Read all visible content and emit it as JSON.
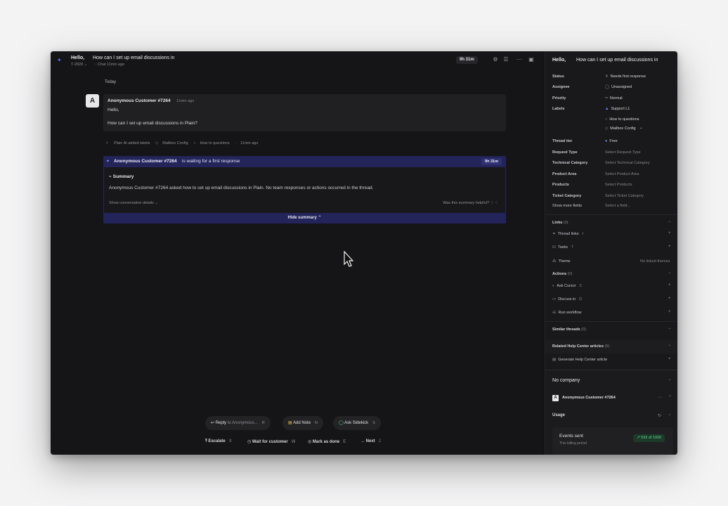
{
  "header": {
    "greeting": "Hello,",
    "thread_title": "How can I set up email discussions in",
    "thread_id": "T-2828 ⌄",
    "channel": "Chat 11min ago",
    "timer": "9h 31m"
  },
  "timeline": {
    "day": "Today",
    "message": {
      "avatar": "A",
      "author": "Anonymous Customer #7264",
      "time": "11min ago",
      "line1": "Hello,",
      "line2": "How can I set up email discussions in Plain?"
    },
    "labels_event": {
      "actor": "Plain AI added labels",
      "label1": "Mailbox Config",
      "label2": "How to questions",
      "time": "11min ago"
    },
    "waiting": {
      "customer": "Anonymous Customer #7264",
      "text": "is waiting for a first response",
      "timer": "9h 31m"
    },
    "summary": {
      "title": "Summary",
      "body": "Anonymous Customer #7264 asked how to set up email discussions in Plain. No team responses or actions occurred in the thread.",
      "show_details": "Show conversation details ⌄",
      "helpful": "Was this summary helpful?",
      "hide": "Hide summary ⌃"
    }
  },
  "composer": {
    "reply": "Reply",
    "reply_to": "to Anonymous...",
    "reply_key": "R",
    "note": "Add Note",
    "note_key": "N",
    "sidekick": "Ask Sidekick",
    "sidekick_key": "S",
    "escalate": "Escalate",
    "escalate_key": "X",
    "wait": "Wait for customer",
    "wait_key": "W",
    "done": "Mark as done",
    "done_key": "E",
    "next": "Next",
    "next_key": "J"
  },
  "sidebar": {
    "greeting": "Hello,",
    "thread_title": "How can I set up email discussions in",
    "fields": {
      "status_label": "Status",
      "status_value": "Needs first response",
      "assignee_label": "Assignee",
      "assignee_value": "Unassigned",
      "priority_label": "Priority",
      "priority_value": "Normal",
      "labels_label": "Labels",
      "label1": "Support L1",
      "label2": "How to questions",
      "label3": "Mailbox Config",
      "tier_label": "Thread tier",
      "tier_value": "Free",
      "request_label": "Request Type",
      "request_value": "Select Request Type",
      "tech_label": "Technical Category",
      "tech_value": "Select Technical Category",
      "area_label": "Product Area",
      "area_value": "Select Product Area",
      "products_label": "Products",
      "products_value": "Select Products",
      "ticket_label": "Ticket Category",
      "ticket_value": "Select Ticket Category",
      "more_label": "Show more fields",
      "more_value": "Select a field..."
    },
    "links": {
      "title": "Links",
      "count": "(0)",
      "thread_links": "Thread links",
      "thread_links_key": "I",
      "tasks": "Tasks",
      "tasks_key": "T",
      "theme": "Theme",
      "theme_value": "No linked themes"
    },
    "actions": {
      "title": "Actions",
      "count": "(0)",
      "cursor": "Ask Cursor",
      "cursor_key": "C",
      "discuss": "Discuss in",
      "discuss_key": "D",
      "workflow": "Run workflow"
    },
    "similar": {
      "title": "Similar threads",
      "count": "(0)"
    },
    "help": {
      "title": "Related Help Center articles",
      "count": "(5)",
      "generate": "Generate Help Center article"
    },
    "company": {
      "title": "No company",
      "avatar": "A",
      "customer": "Anonymous Customer #7264",
      "usage": "Usage",
      "events": "Events sent",
      "period": "This billing period",
      "badge": "593 of 1000"
    }
  },
  "colors": {
    "accent": "#6b6bff",
    "banner": "#23245a",
    "success": "#5fd48d"
  }
}
